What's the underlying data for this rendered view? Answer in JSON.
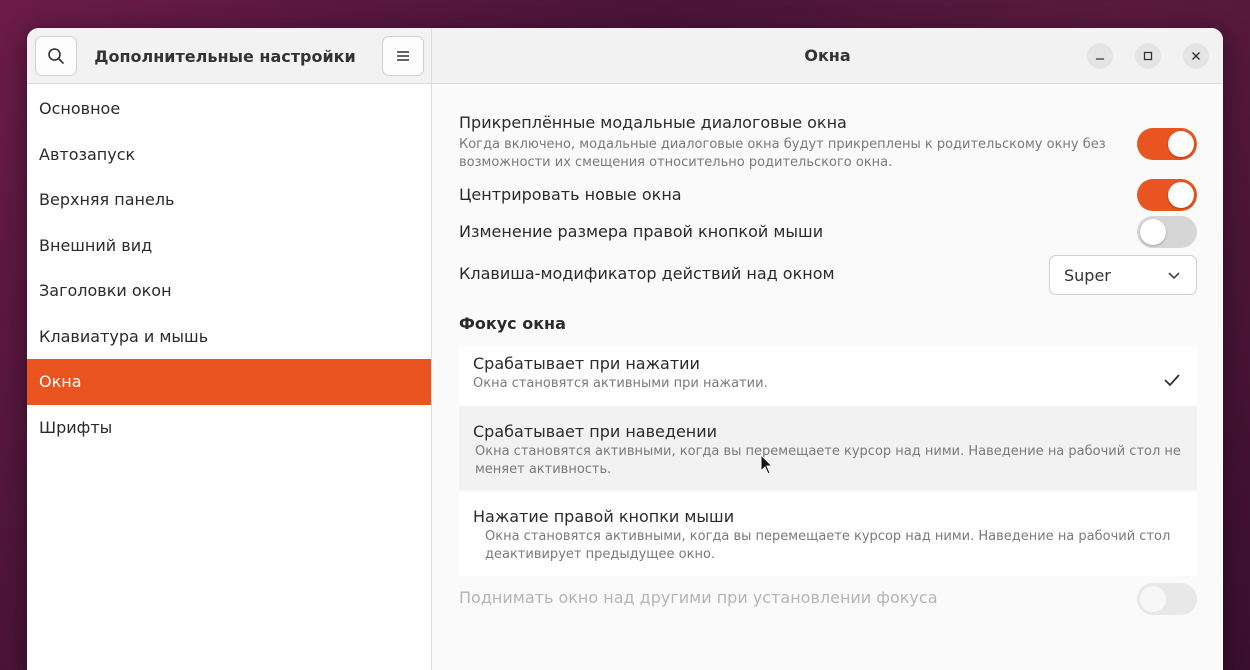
{
  "sidebar": {
    "title": "Дополнительные настройки",
    "items": [
      {
        "label": "Основное"
      },
      {
        "label": "Автозапуск"
      },
      {
        "label": "Верхняя панель"
      },
      {
        "label": "Внешний вид"
      },
      {
        "label": "Заголовки окон"
      },
      {
        "label": "Клавиатура и мышь"
      },
      {
        "label": "Окна",
        "active": true
      },
      {
        "label": "Шрифты"
      }
    ]
  },
  "main": {
    "title": "Окна",
    "settings": [
      {
        "title": "Прикреплённые модальные диалоговые окна",
        "subtitle": "Когда включено, модальные диалоговые окна будут прикреплены к родительскому окну без возможности их смещения относительно родительского окна.",
        "enabled": true
      },
      {
        "title": "Центрировать новые окна",
        "enabled": true
      },
      {
        "title": "Изменение размера правой кнопкой мыши",
        "enabled": false
      },
      {
        "title": "Клавиша-модификатор действий над окном",
        "value": "Super"
      }
    ],
    "focus": {
      "section_title": "Фокус окна",
      "options": [
        {
          "title": "Срабатывает при нажатии",
          "subtitle": "Окна становятся активными при нажатии.",
          "selected": true
        },
        {
          "title": "Срабатывает при наведении",
          "subtitle": "Окна становятся активными, когда вы перемещаете курсор над ними. Наведение на рабочий стол не меняет активность.",
          "selected": false
        },
        {
          "title": "Нажатие правой кнопки мыши",
          "subtitle": "Окна становятся активными, когда вы перемещаете курсор над ними. Наведение на рабочий стол деактивирует предыдущее окно.",
          "selected": false
        }
      ]
    },
    "raise_on_focus": {
      "title": "Поднимать окно над другими при установлении фокуса",
      "enabled": false,
      "disabled": true
    }
  },
  "colors": {
    "accent": "#e95420"
  }
}
